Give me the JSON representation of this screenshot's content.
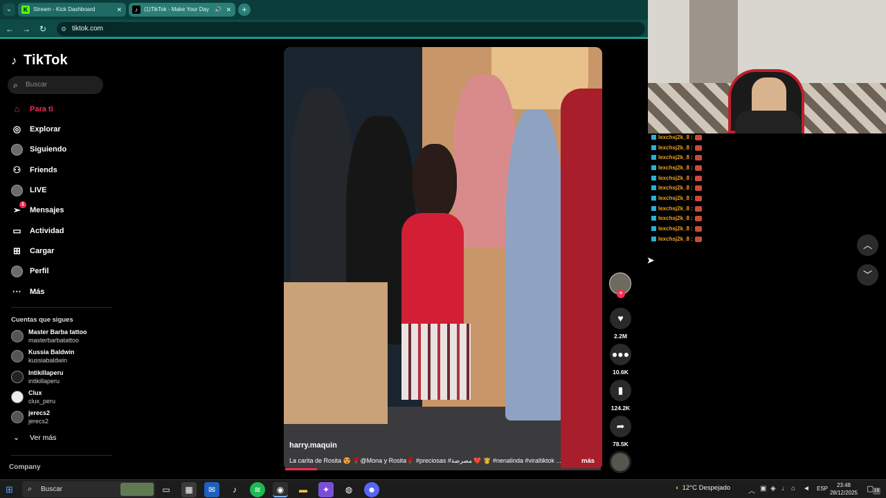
{
  "browser": {
    "tabs": [
      {
        "title": "Stream - Kick Dashboard",
        "favicon": "K",
        "active": false
      },
      {
        "title": "(1)TikTok - Make Your Day",
        "favicon": "♪",
        "active": true
      }
    ],
    "url": "tiktok.com"
  },
  "tiktok": {
    "logo": "TikTok",
    "search_placeholder": "Buscar",
    "nav": [
      {
        "label": "Para ti",
        "icon": "home-icon",
        "active": true
      },
      {
        "label": "Explorar",
        "icon": "compass-icon"
      },
      {
        "label": "Siguiendo",
        "icon": "following-avatar-icon"
      },
      {
        "label": "Friends",
        "icon": "friends-icon"
      },
      {
        "label": "LIVE",
        "icon": "live-icon"
      },
      {
        "label": "Mensajes",
        "icon": "messages-icon",
        "badge": "1"
      },
      {
        "label": "Actividad",
        "icon": "activity-icon"
      },
      {
        "label": "Cargar",
        "icon": "upload-icon"
      },
      {
        "label": "Perfil",
        "icon": "profile-avatar-icon"
      },
      {
        "label": "Más",
        "icon": "more-icon"
      }
    ],
    "following_title": "Cuentas que sigues",
    "following": [
      {
        "name": "Master Barba tattoo",
        "handle": "masterbarbatattoo"
      },
      {
        "name": "Kussia Baldwin",
        "handle": "kussiabaldwin"
      },
      {
        "name": "Intikillaperu",
        "handle": "intikillaperu"
      },
      {
        "name": "Clux",
        "handle": "clux_peru"
      },
      {
        "name": "jerecs2",
        "handle": "jerecs2"
      }
    ],
    "ver_mas": "Ver más",
    "company": "Company"
  },
  "video": {
    "username": "harry.maquin",
    "caption": "La carita de Rosita 😍 🌹@Mona y Rosita🌹 #preciosas #مصرضة ❤️ 👸 #nenalinda #viraltiktok ...",
    "more": "más",
    "progress": 0.1,
    "likes": "2.2M",
    "comments": "10.6K",
    "saves": "124.2K",
    "shares": "78.5K"
  },
  "chat": {
    "lines": [
      "lexchsj2k_8 :",
      "lexchsj2k_8 :",
      "lexchsj2k_8 :",
      "lexchsj2k_8 :",
      "lexchsj2k_8 :",
      "lexchsj2k_8 :",
      "lexchsj2k_8 :",
      "lexchsj2k_8 :",
      "lexchsj2k_8 :",
      "lexchsj2k_8 :",
      "lexchsj2k_8 :"
    ]
  },
  "taskbar": {
    "search": "Buscar",
    "weather": "12°C Despejado",
    "lang": "ESP",
    "time": "23:48",
    "date": "28/12/2025",
    "notifications": "16"
  }
}
